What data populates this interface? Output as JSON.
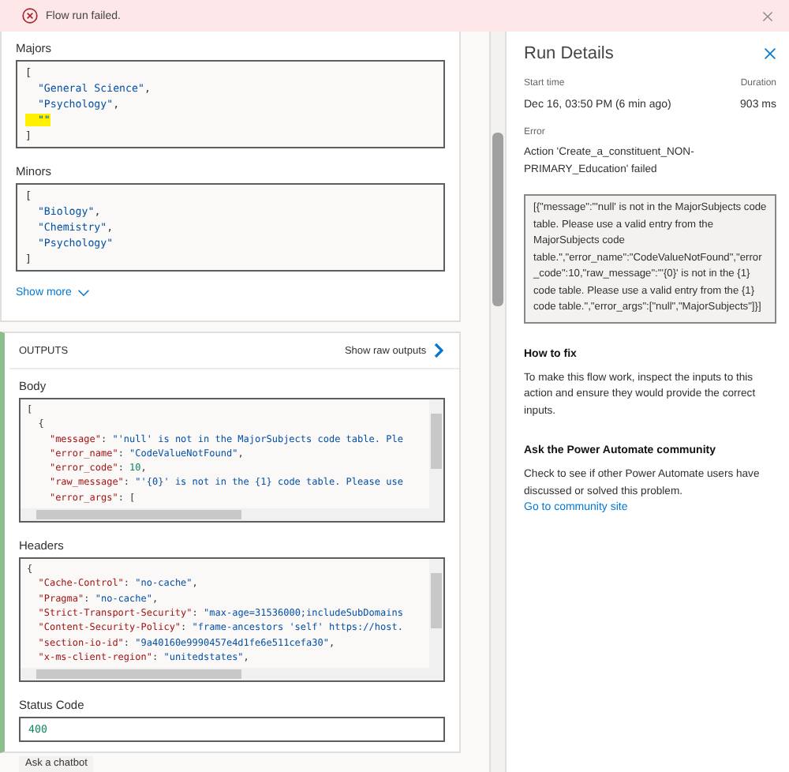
{
  "banner": {
    "message": "Flow run failed."
  },
  "inputs": [
    {
      "label": "Majors",
      "lines": [
        {
          "text": "[",
          "highlighted": false
        },
        {
          "text": "  \"General Science\",",
          "highlighted": false
        },
        {
          "text": "  \"Psychology\",",
          "highlighted": false
        },
        {
          "text": "  \"\"",
          "highlighted": true
        },
        {
          "text": "]",
          "highlighted": false
        }
      ]
    },
    {
      "label": "Minors",
      "lines": [
        {
          "text": "[",
          "highlighted": false
        },
        {
          "text": "  \"Biology\",",
          "highlighted": false
        },
        {
          "text": "  \"Chemistry\",",
          "highlighted": false
        },
        {
          "text": "  \"Psychology\"",
          "highlighted": false
        },
        {
          "text": "]",
          "highlighted": false
        }
      ]
    }
  ],
  "show_more": "Show more",
  "outputs": {
    "title": "OUTPUTS",
    "raw_link": "Show raw outputs",
    "body": {
      "label": "Body",
      "lines": [
        "[",
        "  {",
        "    \"message\": \"'null' is not in the MajorSubjects code table. Ple",
        "    \"error_name\": \"CodeValueNotFound\",",
        "    \"error_code\": 10,",
        "    \"raw_message\": \"'{0}' is not in the {1} code table. Please use",
        "    \"error_args\": ["
      ]
    },
    "headers": {
      "label": "Headers",
      "lines": [
        "{",
        "  \"Cache-Control\": \"no-cache\",",
        "  \"Pragma\": \"no-cache\",",
        "  \"Strict-Transport-Security\": \"max-age=31536000;includeSubDomains",
        "  \"Content-Security-Policy\": \"frame-ancestors 'self' https://host.",
        "  \"section-io-id\": \"9a40160e9990457e4d1fe6e511cefa30\",",
        "  \"x-ms-client-region\": \"unitedstates\","
      ]
    },
    "status": {
      "label": "Status Code",
      "value": "400"
    }
  },
  "chatbot": "Ask a chatbot",
  "run_details": {
    "title": "Run Details",
    "start_label": "Start time",
    "start_value": "Dec 16, 03:50 PM (6 min ago)",
    "duration_label": "Duration",
    "duration_value": "903 ms",
    "error_label": "Error",
    "error_title": "Action 'Create_a_constituent_NON-PRIMARY_Education' failed",
    "error_detail": "[{\"message\":\"'null' is not in the MajorSubjects code table. Please use a valid entry from the MajorSubjects code table.\",\"error_name\":\"CodeValueNotFound\",\"error_code\":10,\"raw_message\":\"'{0}' is not in the {1} code table. Please use a valid entry from the {1} code table.\",\"error_args\":[\"null\",\"MajorSubjects\"]}]",
    "fix_title": "How to fix",
    "fix_text": "To make this flow work, inspect the inputs to this action and ensure they would provide the correct inputs.",
    "community_title": "Ask the Power Automate community",
    "community_text": "Check to see if other Power Automate users have discussed or solved this problem.",
    "community_link": "Go to community site"
  }
}
